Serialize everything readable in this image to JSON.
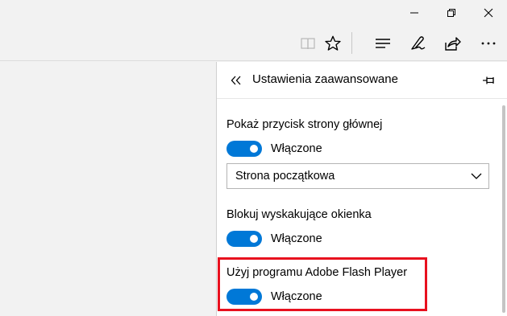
{
  "window_controls": {
    "minimize": "minimize-icon",
    "restore": "restore-icon",
    "close": "close-icon"
  },
  "toolbar": {
    "icons": [
      "reading-view-icon",
      "favorite-star-icon",
      "hub-icon",
      "web-note-icon",
      "share-icon",
      "more-icon"
    ]
  },
  "panel": {
    "title": "Ustawienia zaawansowane",
    "settings": [
      {
        "label": "Pokaż przycisk strony głównej",
        "state": "Włączone"
      },
      {
        "label": "Blokuj wyskakujące okienka",
        "state": "Włączone"
      },
      {
        "label": "Użyj programu Adobe Flash Player",
        "state": "Włączone"
      }
    ],
    "homepage_select": {
      "value": "Strona początkowa"
    }
  },
  "colors": {
    "accent": "#0078d7",
    "highlight": "#e8101e",
    "chrome_bg": "#f2f2f2",
    "panel_bg": "#ffffff"
  }
}
